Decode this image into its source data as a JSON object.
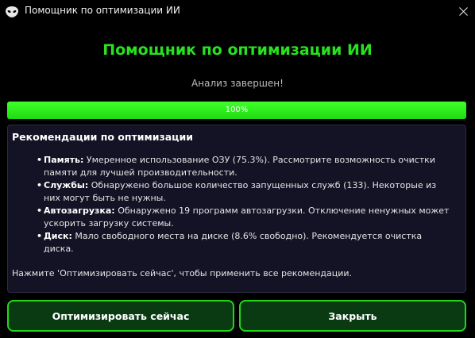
{
  "window": {
    "title": "Помощник по оптимизации ИИ",
    "app_icon": "alien-head-icon",
    "close_icon": "close-icon"
  },
  "main": {
    "heading": "Помощник по оптимизации ИИ",
    "status": "Анализ завершен!",
    "progress": {
      "value_percent": 100,
      "label": "100%"
    }
  },
  "recommendations": {
    "title": "Рекомендации по оптимизации",
    "items": [
      {
        "label": "Память:",
        "text": " Умеренное использование ОЗУ (75.3%). Рассмотрите возможность очистки памяти для лучшей производительности."
      },
      {
        "label": "Службы:",
        "text": " Обнаружено большое количество запущенных служб (133). Некоторые из них могут быть не нужны."
      },
      {
        "label": "Автозагрузка:",
        "text": " Обнаружено 19 программ автозагрузки. Отключение ненужных может ускорить загрузку системы."
      },
      {
        "label": "Диск:",
        "text": " Мало свободного места на диске (8.6% свободно). Рекомендуется очистка диска."
      }
    ],
    "footnote": "Нажмите 'Оптимизировать сейчас', чтобы применить все рекомендации."
  },
  "buttons": {
    "optimize": "Оптимизировать сейчас",
    "close": "Закрыть"
  },
  "colors": {
    "accent_green": "#27e21e",
    "progress_green": "#3fff2a",
    "panel_bg": "#141225",
    "button_bg": "#0a3a12"
  }
}
